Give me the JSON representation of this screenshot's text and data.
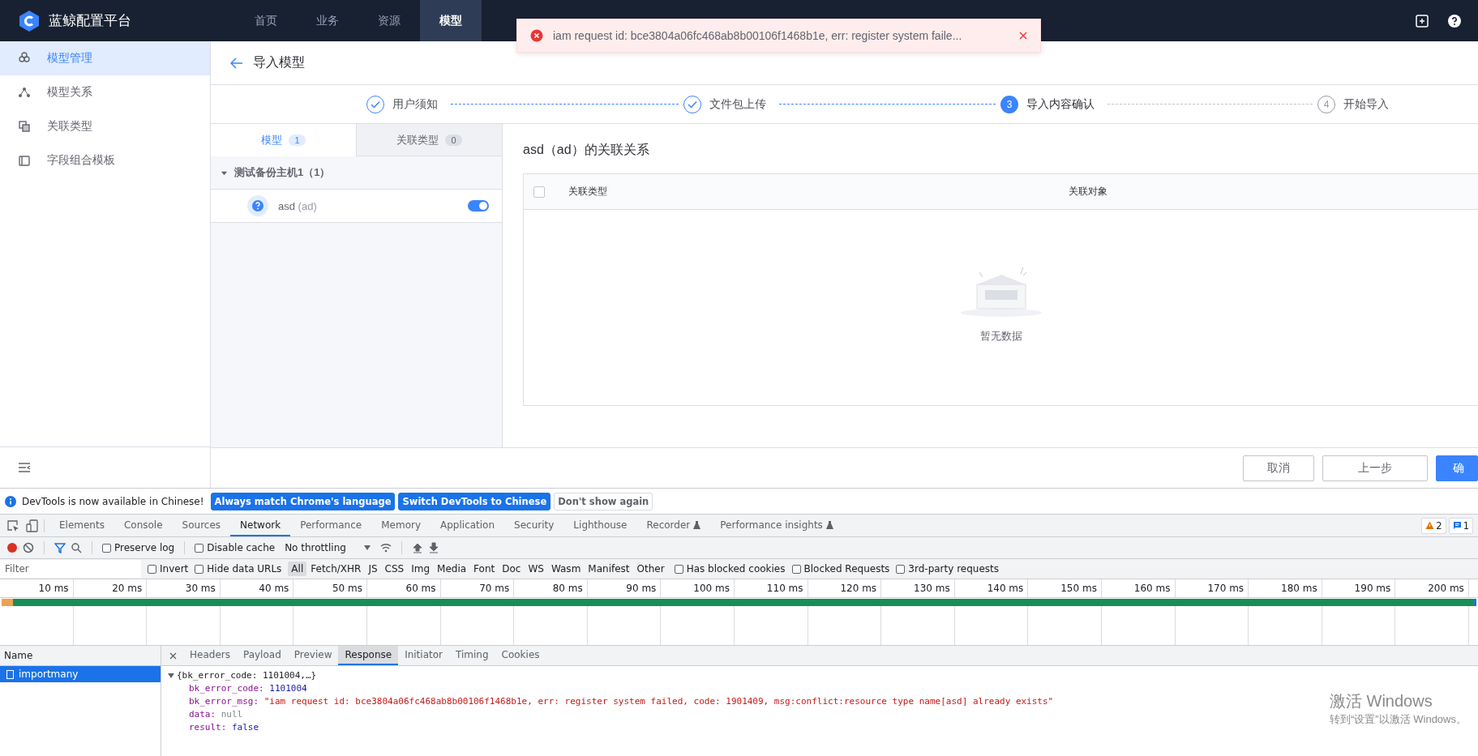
{
  "app": {
    "name": "蓝鲸配置平台"
  },
  "nav": [
    {
      "label": "首页",
      "selected": false
    },
    {
      "label": "业务",
      "selected": false
    },
    {
      "label": "资源",
      "selected": false
    },
    {
      "label": "模型",
      "selected": true
    }
  ],
  "toast": {
    "message": "iam request id: bce3804a06fc468ab8b00106f1468b1e, err: register system faile..."
  },
  "sidebar": {
    "items": [
      {
        "label": "模型管理",
        "selected": true
      },
      {
        "label": "模型关系",
        "selected": false
      },
      {
        "label": "关联类型",
        "selected": false
      },
      {
        "label": "字段组合模板",
        "selected": false
      }
    ]
  },
  "page": {
    "title": "导入模型"
  },
  "steps": [
    {
      "label": "用户须知",
      "done": true,
      "selected": false
    },
    {
      "label": "文件包上传",
      "done": true,
      "selected": false
    },
    {
      "label": "导入内容确认",
      "done": false,
      "selected": true,
      "number": "3"
    },
    {
      "label": "开始导入",
      "done": false,
      "selected": false,
      "number": "4"
    }
  ],
  "left_tabs": [
    {
      "label": "模型",
      "count": "1",
      "selected": true
    },
    {
      "label": "关联类型",
      "count": "0",
      "selected": false
    }
  ],
  "group": {
    "label": "测试备份主机1（1）",
    "expanded": true,
    "children": [
      {
        "name": "asd",
        "id": "(ad)",
        "on": true
      }
    ]
  },
  "relation": {
    "title": "asd（ad）的关联关系",
    "checked": false,
    "columns": [
      "关联类型",
      "关联对象"
    ],
    "empty": "暂无数据"
  },
  "footer_buttons": [
    {
      "label": "取消",
      "kind": "default"
    },
    {
      "label": "上一步",
      "kind": "default"
    },
    {
      "label": "确",
      "kind": "primary"
    }
  ],
  "devtools": {
    "banner": {
      "message": "DevTools is now available in Chinese!",
      "buttons": [
        {
          "label": "Always match Chrome's language",
          "kind": "primary"
        },
        {
          "label": "Switch DevTools to Chinese",
          "kind": "primary"
        },
        {
          "label": "Don't show again",
          "kind": "default"
        }
      ]
    },
    "tabs": [
      {
        "label": "Elements",
        "selected": false,
        "experimental": false
      },
      {
        "label": "Console",
        "selected": false,
        "experimental": false
      },
      {
        "label": "Sources",
        "selected": false,
        "experimental": false
      },
      {
        "label": "Network",
        "selected": true,
        "experimental": false
      },
      {
        "label": "Performance",
        "selected": false,
        "experimental": false
      },
      {
        "label": "Memory",
        "selected": false,
        "experimental": false
      },
      {
        "label": "Application",
        "selected": false,
        "experimental": false
      },
      {
        "label": "Security",
        "selected": false,
        "experimental": false
      },
      {
        "label": "Lighthouse",
        "selected": false,
        "experimental": false
      },
      {
        "label": "Recorder",
        "selected": false,
        "experimental": true
      },
      {
        "label": "Performance insights",
        "selected": false,
        "experimental": true
      }
    ],
    "issues": {
      "warnings": "2",
      "messages": "1"
    },
    "toolbar": {
      "recording": true,
      "preserve_log": {
        "label": "Preserve log",
        "checked": false
      },
      "disable_cache": {
        "label": "Disable cache",
        "checked": false
      },
      "throttling": "No throttling"
    },
    "filter": {
      "placeholder": "Filter",
      "options": [
        {
          "label": "Invert",
          "checked": false
        },
        {
          "label": "Hide data URLs",
          "checked": false
        }
      ],
      "types": [
        {
          "label": "All",
          "selected": true
        },
        {
          "label": "Fetch/XHR",
          "selected": false
        },
        {
          "label": "JS",
          "selected": false
        },
        {
          "label": "CSS",
          "selected": false
        },
        {
          "label": "Img",
          "selected": false
        },
        {
          "label": "Media",
          "selected": false
        },
        {
          "label": "Font",
          "selected": false
        },
        {
          "label": "Doc",
          "selected": false
        },
        {
          "label": "WS",
          "selected": false
        },
        {
          "label": "Wasm",
          "selected": false
        },
        {
          "label": "Manifest",
          "selected": false
        },
        {
          "label": "Other",
          "selected": false
        }
      ],
      "extra": [
        {
          "label": "Has blocked cookies",
          "checked": false
        },
        {
          "label": "Blocked Requests",
          "checked": false
        },
        {
          "label": "3rd-party requests",
          "checked": false
        }
      ]
    },
    "timeline": {
      "ticks": [
        "10 ms",
        "20 ms",
        "30 ms",
        "40 ms",
        "50 ms",
        "60 ms",
        "70 ms",
        "80 ms",
        "90 ms",
        "100 ms",
        "110 ms",
        "120 ms",
        "130 ms",
        "140 ms",
        "150 ms",
        "160 ms",
        "170 ms",
        "180 ms",
        "190 ms",
        "200 ms"
      ]
    },
    "name_header": "Name",
    "requests": [
      {
        "name": "importmany",
        "selected": true
      }
    ],
    "detail_tabs": [
      {
        "label": "Headers",
        "selected": false
      },
      {
        "label": "Payload",
        "selected": false
      },
      {
        "label": "Preview",
        "selected": false
      },
      {
        "label": "Response",
        "selected": true
      },
      {
        "label": "Initiator",
        "selected": false
      },
      {
        "label": "Timing",
        "selected": false
      },
      {
        "label": "Cookies",
        "selected": false
      }
    ],
    "response": {
      "summary": "{bk_error_code: 1101004,…}",
      "expanded": true,
      "fields": [
        {
          "key": "bk_error_code:",
          "value": "1101004",
          "kind": "number"
        },
        {
          "key": "bk_error_msg:",
          "value": "\"iam request id: bce3804a06fc468ab8b00106f1468b1e, err: register system failed, code: 1901409, msg:conflict:resource type name[asd] already exists\"",
          "kind": "string"
        },
        {
          "key": "data:",
          "value": "null",
          "kind": "null"
        },
        {
          "key": "result:",
          "value": "false",
          "kind": "boolean"
        }
      ]
    }
  },
  "os_notice": {
    "title": "激活 Windows",
    "subtitle": "转到“设置”以激活 Windows。"
  }
}
